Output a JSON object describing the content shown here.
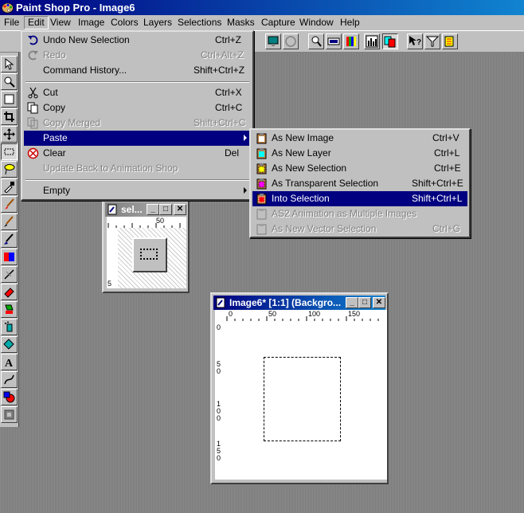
{
  "app": {
    "title": "Paint Shop Pro - Image6"
  },
  "menubar": {
    "items": [
      "File",
      "View",
      "Image",
      "Colors",
      "Layers",
      "Selections",
      "Masks",
      "Capture",
      "Window",
      "Help"
    ],
    "file": "File",
    "edit": "Edit",
    "view": "View",
    "image": "Image",
    "colors": "Colors",
    "layers": "Layers",
    "selections": "Selections",
    "masks": "Masks",
    "capture": "Capture",
    "window": "Window",
    "help": "Help"
  },
  "edit_menu": {
    "undo": {
      "label": "Undo New Selection",
      "shortcut": "Ctrl+Z"
    },
    "redo": {
      "label": "Redo",
      "shortcut": "Ctrl+Alt+Z"
    },
    "history": {
      "label": "Command History...",
      "shortcut": "Shift+Ctrl+Z"
    },
    "cut": {
      "label": "Cut",
      "shortcut": "Ctrl+X"
    },
    "copy": {
      "label": "Copy",
      "shortcut": "Ctrl+C"
    },
    "copy_merged": {
      "label": "Copy Merged",
      "shortcut": "Shift+Ctrl+C"
    },
    "paste": {
      "label": "Paste"
    },
    "clear": {
      "label": "Clear",
      "shortcut": "Del"
    },
    "update_back": {
      "label": "Update Back to Animation Shop"
    },
    "empty": {
      "label": "Empty"
    }
  },
  "paste_menu": {
    "new_image": {
      "label": "As New Image",
      "shortcut": "Ctrl+V"
    },
    "new_layer": {
      "label": "As New Layer",
      "shortcut": "Ctrl+L"
    },
    "new_selection": {
      "label": "As New Selection",
      "shortcut": "Ctrl+E"
    },
    "transparent": {
      "label": "As Transparent Selection",
      "shortcut": "Shift+Ctrl+E"
    },
    "into_selection": {
      "label": "Into Selection",
      "shortcut": "Shift+Ctrl+L"
    },
    "as2": {
      "label": "AS2 Animation as Multiple Images"
    },
    "vector": {
      "label": "As New Vector Selection",
      "shortcut": "Ctrl+G"
    }
  },
  "sel_window": {
    "title": "sel...",
    "ruler_top": "50",
    "ruler_left": "5"
  },
  "image_window": {
    "title": "Image6* [1:1] (Backgro...",
    "ruler_top": [
      "0",
      "50",
      "100",
      "150"
    ],
    "ruler_left": [
      "0",
      "5 0",
      "1 0 0",
      "1 5 0"
    ]
  },
  "colors": {
    "menu_highlight": "#000080",
    "face": "#c0c0c0",
    "workspace": "#808080"
  }
}
